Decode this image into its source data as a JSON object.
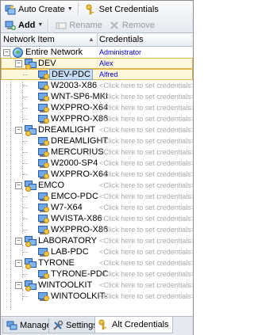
{
  "toolbar": {
    "auto_create_label": "Auto Create",
    "set_credentials_label": "Set Credentials",
    "add_label": "Add",
    "rename_label": "Rename",
    "remove_label": "Remove"
  },
  "columns": {
    "network_item": "Network Item",
    "credentials": "Credentials"
  },
  "tree": {
    "root": {
      "label": "Entire Network",
      "cred": "Administrator"
    },
    "groups": [
      {
        "label": "DEV",
        "cred": "Alex",
        "items": [
          {
            "label": "DEV-PDC",
            "cred": "Alfred"
          },
          {
            "label": "W2003-X86",
            "cred": "<Click here to set credentials>"
          },
          {
            "label": "WNT-SP6-MKI",
            "cred": "<Click here to set credentials>"
          },
          {
            "label": "WXPPRO-X64",
            "cred": "<Click here to set credentials>"
          },
          {
            "label": "WXPPRO-X86",
            "cred": "<Click here to set credentials>"
          }
        ]
      },
      {
        "label": "DREAMLIGHT",
        "cred": "<Click here to set credentials>",
        "items": [
          {
            "label": "DREAMLIGHT",
            "cred": "<Click here to set credentials>"
          },
          {
            "label": "MERCURIUS",
            "cred": "<Click here to set credentials>"
          },
          {
            "label": "W2000-SP4",
            "cred": "<Click here to set credentials>"
          },
          {
            "label": "WXPPRO-X64",
            "cred": "<Click here to set credentials>"
          }
        ]
      },
      {
        "label": "EMCO",
        "cred": "<Click here to set credentials>",
        "items": [
          {
            "label": "EMCO-PDC",
            "cred": "<Click here to set credentials>"
          },
          {
            "label": "W7-X64",
            "cred": "<Click here to set credentials>"
          },
          {
            "label": "WVISTA-X86",
            "cred": "<Click here to set credentials>"
          },
          {
            "label": "WXPPRO-X86",
            "cred": "<Click here to set credentials>"
          }
        ]
      },
      {
        "label": "LABORATORY",
        "cred": "<Click here to set credentials>",
        "items": [
          {
            "label": "LAB-PDC",
            "cred": "<Click here to set credentials>"
          }
        ]
      },
      {
        "label": "TYRONE",
        "cred": "<Click here to set credentials>",
        "items": [
          {
            "label": "TYRONE-PDC",
            "cred": "<Click here to set credentials>"
          }
        ]
      },
      {
        "label": "WINTOOLKIT",
        "cred": "<Click here to set credentials>",
        "items": [
          {
            "label": "WINTOOLKIT-",
            "cred": "<Click here to set credentials>"
          }
        ]
      }
    ]
  },
  "tabs": [
    {
      "label": "Manage",
      "icon": "manage-icon"
    },
    {
      "label": "Settings",
      "icon": "settings-icon"
    },
    {
      "label": "Alt Credentials",
      "icon": "alt-credentials-icon",
      "active": true
    }
  ],
  "colors": {
    "set_credential": "#0000d0",
    "unset_credential": "#a8a8a8",
    "selection_border": "#e0b54c"
  }
}
